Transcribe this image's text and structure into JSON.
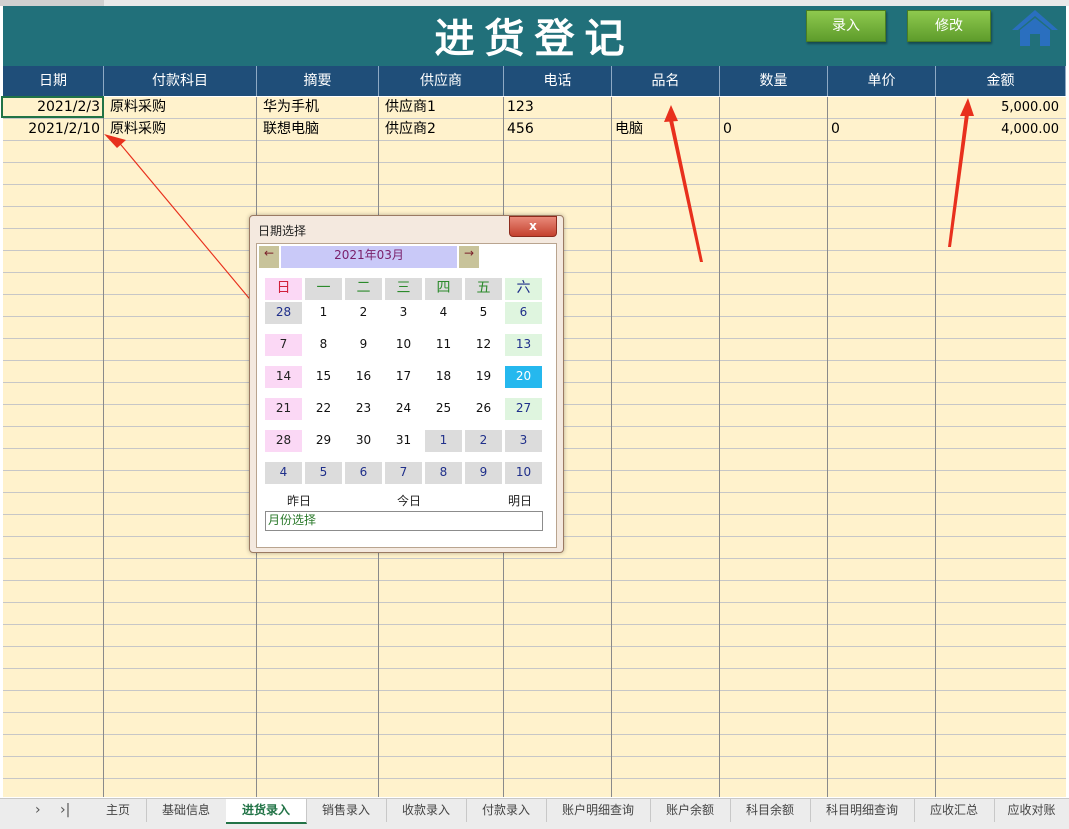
{
  "sheet": {
    "title": "进货登记",
    "buttons": {
      "enter": "录入",
      "modify": "修改"
    },
    "home_icon": "home-icon",
    "columns": [
      "日期",
      "付款科目",
      "摘要",
      "供应商",
      "电话",
      "品名",
      "数量",
      "单价",
      "金额"
    ],
    "rows": [
      {
        "date": "2021/2/3",
        "account": "原料采购",
        "summary": "华为手机",
        "supplier": "供应商1",
        "phone": "123",
        "product": "",
        "qty": "",
        "price": "",
        "amount": "5,000.00"
      },
      {
        "date": "2021/2/10",
        "account": "原料采购",
        "summary": "联想电脑",
        "supplier": "供应商2",
        "phone": "456",
        "product": "电脑",
        "qty": "0",
        "price": "0",
        "amount": "4,000.00"
      }
    ]
  },
  "date_picker": {
    "title": "日期选择",
    "close": "x",
    "prev": "←",
    "next": "→",
    "month_label": "2021年03月",
    "weekdays": [
      "日",
      "一",
      "二",
      "三",
      "四",
      "五",
      "六"
    ],
    "weeks": [
      [
        "28",
        "1",
        "2",
        "3",
        "4",
        "5",
        "6"
      ],
      [
        "7",
        "8",
        "9",
        "10",
        "11",
        "12",
        "13"
      ],
      [
        "14",
        "15",
        "16",
        "17",
        "18",
        "19",
        "20"
      ],
      [
        "21",
        "22",
        "23",
        "24",
        "25",
        "26",
        "27"
      ],
      [
        "28",
        "29",
        "30",
        "31",
        "1",
        "2",
        "3"
      ],
      [
        "4",
        "5",
        "6",
        "7",
        "8",
        "9",
        "10"
      ]
    ],
    "selected_day": "20",
    "yesterday": "昨日",
    "today": "今日",
    "tomorrow": "明日",
    "month_select": "月份选择"
  },
  "sheet_tabs": [
    "主页",
    "基础信息",
    "进货录入",
    "销售录入",
    "收款录入",
    "付款录入",
    "账户明细查询",
    "账户余额",
    "科目余额",
    "科目明细查询",
    "应收汇总",
    "应收对账"
  ],
  "active_tab": "进货录入",
  "colors": {
    "header_bg": "#21707a",
    "column_header_bg": "#1f4e79",
    "grid_bg": "#fff2cc",
    "arrow": "#e8301d",
    "button_green": "#6cae35"
  }
}
